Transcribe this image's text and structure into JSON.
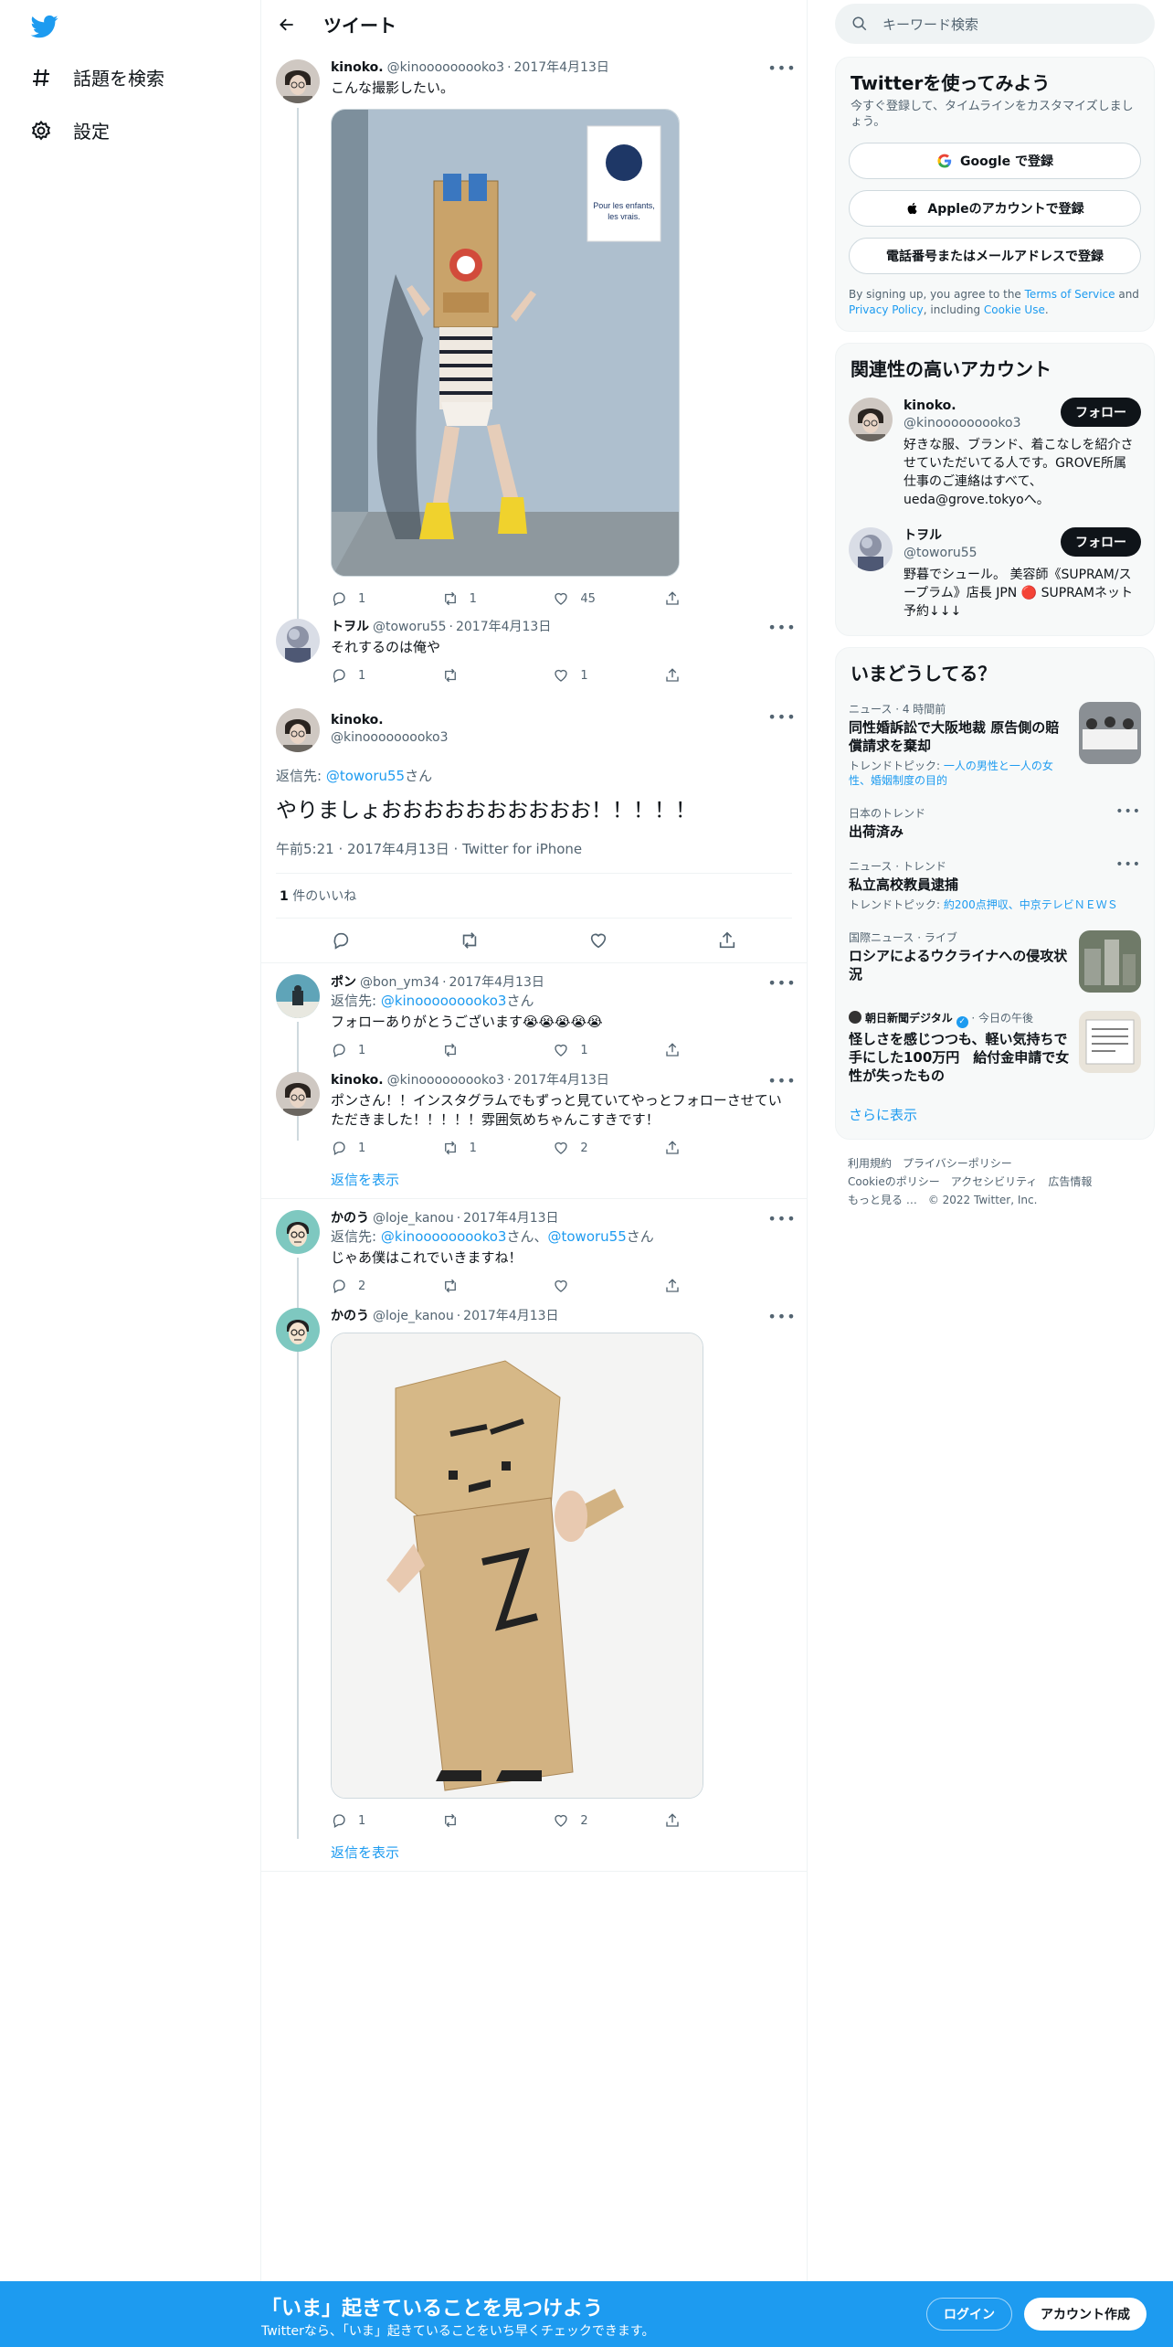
{
  "nav": {
    "logo_icon": "twitter-bird-icon",
    "items": [
      {
        "icon": "hashtag-icon",
        "label": "話題を検索"
      },
      {
        "icon": "gear-icon",
        "label": "設定"
      }
    ]
  },
  "header": {
    "title": "ツイート"
  },
  "tweets": [
    {
      "name": "kinoko.",
      "handle": "@kinooooooooko3",
      "date": "2017年4月13日",
      "text": "こんな撮影したい。",
      "reply": "1",
      "retweet": "1",
      "like": "45"
    },
    {
      "name": "トヲル",
      "handle": "@toworu55",
      "date": "2017年4月13日",
      "text": "それするのは俺や",
      "reply": "1",
      "retweet": "",
      "like": "1"
    }
  ],
  "focus": {
    "name": "kinoko.",
    "handle": "@kinooooooooko3",
    "reply_prefix": "返信先: ",
    "reply_link": "@toworu55",
    "reply_suffix": "さん",
    "text": "やりましょおおおおおおおおおお！！！！！",
    "meta": "午前5:21 · 2017年4月13日 · Twitter for iPhone",
    "likes_count": "1",
    "likes_label": " 件のいいね"
  },
  "replies": [
    {
      "name": "ポン",
      "handle": "@bon_ym34",
      "date": "2017年4月13日",
      "reply_prefix": "返信先: ",
      "reply_link": "@kinooooooooko3",
      "reply_suffix": "さん",
      "text": "フォローありがとうございます😭😭😭😭😭",
      "reply": "1",
      "retweet": "",
      "like": "1"
    },
    {
      "name": "kinoko.",
      "handle": "@kinooooooooko3",
      "date": "2017年4月13日",
      "text": "ポンさん！！インスタグラムでもずっと見ていてやっとフォローさせていただきました！！！！！雰囲気めちゃんこすきです！",
      "reply": "1",
      "retweet": "1",
      "like": "2",
      "show_replies": "返信を表示"
    },
    {
      "name": "かのう",
      "handle": "@loje_kanou",
      "date": "2017年4月13日",
      "reply_prefix": "返信先: ",
      "reply_link": "@kinooooooooko3",
      "reply_mid": "さん、",
      "reply_link2": "@toworu55",
      "reply_suffix": "さん",
      "text": "じゃあ僕はこれでいきますね！",
      "reply": "2",
      "retweet": "",
      "like": ""
    },
    {
      "name": "かのう",
      "handle": "@loje_kanou",
      "date": "2017年4月13日",
      "text": "",
      "reply": "1",
      "retweet": "",
      "like": "2",
      "show_replies": "返信を表示"
    }
  ],
  "sidebar": {
    "search_placeholder": "キーワード検索",
    "signup": {
      "title": "Twitterを使ってみよう",
      "subtitle": "今すぐ登録して、タイムラインをカスタマイズしましょう。",
      "google": "Google で登録",
      "apple": "Appleのアカウントで登録",
      "phone": "電話番号またはメールアドレスで登録",
      "terms_1": "By signing up, you agree to the ",
      "terms_link1": "Terms of Service",
      "terms_2": " and ",
      "terms_link2": "Privacy Policy",
      "terms_3": ", including ",
      "terms_link3": "Cookie Use",
      "terms_4": "."
    },
    "relevant": {
      "title": "関連性の高いアカウント",
      "follow_label": "フォロー",
      "accounts": [
        {
          "name": "kinoko.",
          "handle": "@kinooooooooko3",
          "bio": "好きな服、ブランド、着こなしを紹介させていただいてる人です。GROVE所属 仕事のご連絡はすべて、ueda@grove.tokyoへ。"
        },
        {
          "name": "トヲル",
          "handle": "@toworu55",
          "bio": "野暮でシュール。 美容師《SUPRAM/スープラム》店長 JPN 🔴 SUPRAMネット予約↓↓↓"
        }
      ]
    },
    "trends": {
      "title": "いまどうしてる？",
      "items": [
        {
          "cat": "ニュース · 4 時間前",
          "title": "同性婚訴訟で大阪地裁 原告側の賠償請求を棄却",
          "sub_prefix": "トレンドトピック: ",
          "sub": "一人の男性と一人の女性、婚姻制度の目的"
        },
        {
          "cat": "日本のトレンド",
          "title": "出荷済み"
        },
        {
          "cat": "ニュース · トレンド",
          "title": "私立高校教員逮捕",
          "sub_prefix": "トレンドトピック: ",
          "sub": "約200点押収、中京テレビＮＥＷＳ"
        },
        {
          "cat": "国際ニュース · ライブ",
          "title": "ロシアによるウクライナへの侵攻状況"
        },
        {
          "cat": "朝日新聞デジタル",
          "cat_time": " · 今日の午後",
          "title": "怪しさを感じつつも、軽い気持ちで手にした100万円　給付金申請で女性が失ったもの"
        }
      ],
      "show_more": "さらに表示"
    },
    "footer": [
      "利用規約",
      "プライバシーポリシー",
      "Cookieのポリシー",
      "アクセシビリティ",
      "広告情報",
      "もっと見る …",
      "© 2022 Twitter, Inc."
    ]
  },
  "bottom": {
    "title": "「いま」起きていることを見つけよう",
    "subtitle": "Twitterなら、「いま」起きていることをいち早くチェックできます。",
    "login": "ログイン",
    "signup": "アカウント作成"
  },
  "colors": {
    "accent": "#1d9bf0",
    "text": "#0f1419",
    "secondary": "#536471"
  }
}
